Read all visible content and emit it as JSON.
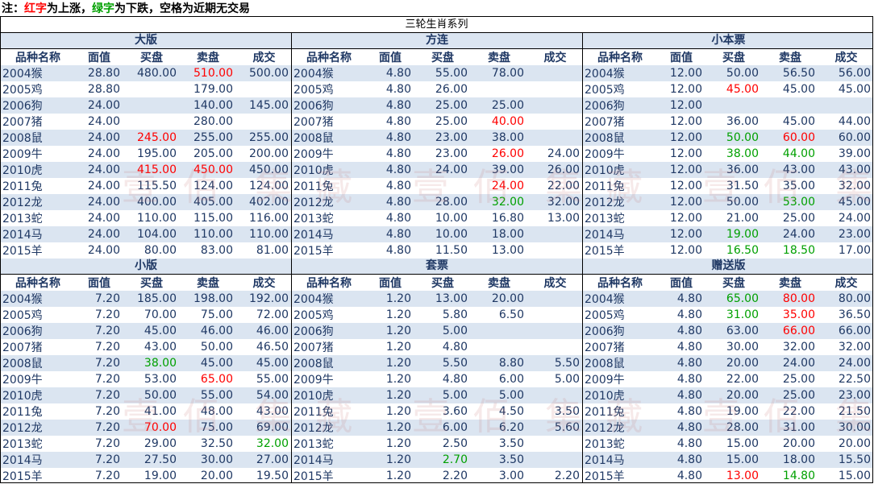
{
  "note": {
    "prefix": "注：",
    "red_word": "红字",
    "red_rest": "为上涨，",
    "green_word": "绿字",
    "green_rest": "为下跌，空格为近期无交易"
  },
  "title": "三轮生肖系列",
  "colors": {
    "up": "#ff0000",
    "down": "#00a000",
    "text": "#1f3864",
    "stripe": "#dbe5f1"
  },
  "columns": [
    "品种名称",
    "面值",
    "买盘",
    "卖盘",
    "成交"
  ],
  "sections": [
    {
      "title": "大版",
      "rows": [
        {
          "name": "2004猴",
          "face": "28.80",
          "bid": "480.00",
          "ask": "510.00",
          "deal": "500.00",
          "bid_c": "",
          "ask_c": "up",
          "deal_c": ""
        },
        {
          "name": "2005鸡",
          "face": "28.80",
          "bid": "",
          "ask": "179.00",
          "deal": "",
          "bid_c": "",
          "ask_c": "",
          "deal_c": ""
        },
        {
          "name": "2006狗",
          "face": "24.00",
          "bid": "",
          "ask": "140.00",
          "deal": "145.00",
          "bid_c": "",
          "ask_c": "",
          "deal_c": ""
        },
        {
          "name": "2007猪",
          "face": "24.00",
          "bid": "",
          "ask": "280.00",
          "deal": "",
          "bid_c": "",
          "ask_c": "",
          "deal_c": ""
        },
        {
          "name": "2008鼠",
          "face": "24.00",
          "bid": "245.00",
          "ask": "255.00",
          "deal": "255.00",
          "bid_c": "up",
          "ask_c": "",
          "deal_c": ""
        },
        {
          "name": "2009牛",
          "face": "24.00",
          "bid": "195.00",
          "ask": "205.00",
          "deal": "200.00",
          "bid_c": "",
          "ask_c": "",
          "deal_c": ""
        },
        {
          "name": "2010虎",
          "face": "24.00",
          "bid": "415.00",
          "ask": "450.00",
          "deal": "450.00",
          "bid_c": "up",
          "ask_c": "up",
          "deal_c": ""
        },
        {
          "name": "2011兔",
          "face": "24.00",
          "bid": "115.50",
          "ask": "124.00",
          "deal": "124.00",
          "bid_c": "",
          "ask_c": "",
          "deal_c": ""
        },
        {
          "name": "2012龙",
          "face": "24.00",
          "bid": "400.00",
          "ask": "405.00",
          "deal": "402.00",
          "bid_c": "",
          "ask_c": "",
          "deal_c": ""
        },
        {
          "name": "2013蛇",
          "face": "24.00",
          "bid": "110.00",
          "ask": "115.00",
          "deal": "116.00",
          "bid_c": "",
          "ask_c": "",
          "deal_c": ""
        },
        {
          "name": "2014马",
          "face": "24.00",
          "bid": "104.00",
          "ask": "110.00",
          "deal": "110.00",
          "bid_c": "",
          "ask_c": "",
          "deal_c": ""
        },
        {
          "name": "2015羊",
          "face": "24.00",
          "bid": "80.00",
          "ask": "83.00",
          "deal": "81.00",
          "bid_c": "",
          "ask_c": "",
          "deal_c": ""
        }
      ]
    },
    {
      "title": "方连",
      "rows": [
        {
          "name": "2004猴",
          "face": "4.80",
          "bid": "55.00",
          "ask": "78.00",
          "deal": "",
          "bid_c": "",
          "ask_c": "",
          "deal_c": ""
        },
        {
          "name": "2005鸡",
          "face": "4.80",
          "bid": "26.00",
          "ask": "",
          "deal": "",
          "bid_c": "",
          "ask_c": "",
          "deal_c": ""
        },
        {
          "name": "2006狗",
          "face": "4.80",
          "bid": "25.00",
          "ask": "25.00",
          "deal": "",
          "bid_c": "",
          "ask_c": "",
          "deal_c": ""
        },
        {
          "name": "2007猪",
          "face": "4.80",
          "bid": "25.00",
          "ask": "40.00",
          "deal": "",
          "bid_c": "",
          "ask_c": "up",
          "deal_c": ""
        },
        {
          "name": "2008鼠",
          "face": "4.80",
          "bid": "23.00",
          "ask": "38.00",
          "deal": "",
          "bid_c": "",
          "ask_c": "",
          "deal_c": ""
        },
        {
          "name": "2009牛",
          "face": "4.80",
          "bid": "23.00",
          "ask": "26.00",
          "deal": "24.00",
          "bid_c": "",
          "ask_c": "up",
          "deal_c": ""
        },
        {
          "name": "2010虎",
          "face": "4.80",
          "bid": "24.00",
          "ask": "39.00",
          "deal": "26.00",
          "bid_c": "",
          "ask_c": "",
          "deal_c": ""
        },
        {
          "name": "2011兔",
          "face": "4.80",
          "bid": "",
          "ask": "24.00",
          "deal": "22.00",
          "bid_c": "",
          "ask_c": "up",
          "deal_c": ""
        },
        {
          "name": "2012龙",
          "face": "4.80",
          "bid": "28.00",
          "ask": "32.00",
          "deal": "32.00",
          "bid_c": "",
          "ask_c": "down",
          "deal_c": ""
        },
        {
          "name": "2013蛇",
          "face": "4.80",
          "bid": "10.00",
          "ask": "16.80",
          "deal": "13.00",
          "bid_c": "",
          "ask_c": "",
          "deal_c": ""
        },
        {
          "name": "2014马",
          "face": "4.80",
          "bid": "10.00",
          "ask": "18.00",
          "deal": "",
          "bid_c": "",
          "ask_c": "",
          "deal_c": ""
        },
        {
          "name": "2015羊",
          "face": "4.80",
          "bid": "11.50",
          "ask": "13.00",
          "deal": "",
          "bid_c": "",
          "ask_c": "",
          "deal_c": ""
        }
      ]
    },
    {
      "title": "小本票",
      "rows": [
        {
          "name": "2004猴",
          "face": "12.00",
          "bid": "50.00",
          "ask": "56.50",
          "deal": "56.00",
          "bid_c": "",
          "ask_c": "",
          "deal_c": ""
        },
        {
          "name": "2005鸡",
          "face": "12.00",
          "bid": "45.00",
          "ask": "45.00",
          "deal": "45.00",
          "bid_c": "up",
          "ask_c": "",
          "deal_c": ""
        },
        {
          "name": "2006狗",
          "face": "12.00",
          "bid": "",
          "ask": "",
          "deal": "",
          "bid_c": "",
          "ask_c": "",
          "deal_c": ""
        },
        {
          "name": "2007猪",
          "face": "12.00",
          "bid": "36.00",
          "ask": "45.00",
          "deal": "44.00",
          "bid_c": "",
          "ask_c": "",
          "deal_c": ""
        },
        {
          "name": "2008鼠",
          "face": "12.00",
          "bid": "50.00",
          "ask": "60.00",
          "deal": "60.00",
          "bid_c": "down",
          "ask_c": "up",
          "deal_c": ""
        },
        {
          "name": "2009牛",
          "face": "12.00",
          "bid": "38.00",
          "ask": "44.00",
          "deal": "39.00",
          "bid_c": "down",
          "ask_c": "down",
          "deal_c": ""
        },
        {
          "name": "2010虎",
          "face": "12.00",
          "bid": "36.00",
          "ask": "43.00",
          "deal": "43.00",
          "bid_c": "",
          "ask_c": "",
          "deal_c": ""
        },
        {
          "name": "2011兔",
          "face": "12.00",
          "bid": "31.50",
          "ask": "35.00",
          "deal": "32.00",
          "bid_c": "",
          "ask_c": "",
          "deal_c": ""
        },
        {
          "name": "2012龙",
          "face": "12.00",
          "bid": "50.00",
          "ask": "53.00",
          "deal": "45.00",
          "bid_c": "",
          "ask_c": "down",
          "deal_c": ""
        },
        {
          "name": "2013蛇",
          "face": "12.00",
          "bid": "21.00",
          "ask": "25.00",
          "deal": "24.00",
          "bid_c": "",
          "ask_c": "",
          "deal_c": ""
        },
        {
          "name": "2014马",
          "face": "12.00",
          "bid": "19.00",
          "ask": "24.00",
          "deal": "23.00",
          "bid_c": "down",
          "ask_c": "",
          "deal_c": ""
        },
        {
          "name": "2015羊",
          "face": "12.00",
          "bid": "16.50",
          "ask": "18.50",
          "deal": "17.00",
          "bid_c": "down",
          "ask_c": "down",
          "deal_c": ""
        }
      ]
    },
    {
      "title": "小版",
      "rows": [
        {
          "name": "2004猴",
          "face": "7.20",
          "bid": "185.00",
          "ask": "198.00",
          "deal": "192.00",
          "bid_c": "",
          "ask_c": "",
          "deal_c": ""
        },
        {
          "name": "2005鸡",
          "face": "7.20",
          "bid": "70.00",
          "ask": "75.00",
          "deal": "72.00",
          "bid_c": "",
          "ask_c": "",
          "deal_c": ""
        },
        {
          "name": "2006狗",
          "face": "7.20",
          "bid": "45.00",
          "ask": "46.00",
          "deal": "46.00",
          "bid_c": "",
          "ask_c": "",
          "deal_c": ""
        },
        {
          "name": "2007猪",
          "face": "7.20",
          "bid": "43.00",
          "ask": "50.00",
          "deal": "46.50",
          "bid_c": "",
          "ask_c": "",
          "deal_c": ""
        },
        {
          "name": "2008鼠",
          "face": "7.20",
          "bid": "38.00",
          "ask": "45.00",
          "deal": "45.00",
          "bid_c": "down",
          "ask_c": "",
          "deal_c": ""
        },
        {
          "name": "2009牛",
          "face": "7.20",
          "bid": "53.00",
          "ask": "65.00",
          "deal": "55.00",
          "bid_c": "",
          "ask_c": "up",
          "deal_c": ""
        },
        {
          "name": "2010虎",
          "face": "7.20",
          "bid": "50.00",
          "ask": "55.00",
          "deal": "54.00",
          "bid_c": "",
          "ask_c": "",
          "deal_c": ""
        },
        {
          "name": "2011兔",
          "face": "7.20",
          "bid": "41.00",
          "ask": "48.00",
          "deal": "43.00",
          "bid_c": "",
          "ask_c": "",
          "deal_c": ""
        },
        {
          "name": "2012龙",
          "face": "7.20",
          "bid": "70.00",
          "ask": "75.00",
          "deal": "69.00",
          "bid_c": "up",
          "ask_c": "",
          "deal_c": ""
        },
        {
          "name": "2013蛇",
          "face": "7.20",
          "bid": "29.00",
          "ask": "32.50",
          "deal": "32.00",
          "bid_c": "",
          "ask_c": "",
          "deal_c": "down"
        },
        {
          "name": "2014马",
          "face": "7.20",
          "bid": "27.50",
          "ask": "30.00",
          "deal": "27.00",
          "bid_c": "",
          "ask_c": "",
          "deal_c": ""
        },
        {
          "name": "2015羊",
          "face": "7.20",
          "bid": "19.00",
          "ask": "20.00",
          "deal": "19.50",
          "bid_c": "",
          "ask_c": "",
          "deal_c": ""
        }
      ]
    },
    {
      "title": "套票",
      "rows": [
        {
          "name": "2004猴",
          "face": "1.20",
          "bid": "13.00",
          "ask": "20.00",
          "deal": "",
          "bid_c": "",
          "ask_c": "",
          "deal_c": ""
        },
        {
          "name": "2005鸡",
          "face": "1.20",
          "bid": "5.80",
          "ask": "6.50",
          "deal": "",
          "bid_c": "",
          "ask_c": "",
          "deal_c": ""
        },
        {
          "name": "2006狗",
          "face": "1.20",
          "bid": "5.00",
          "ask": "",
          "deal": "",
          "bid_c": "",
          "ask_c": "",
          "deal_c": ""
        },
        {
          "name": "2007猪",
          "face": "1.20",
          "bid": "4.80",
          "ask": "",
          "deal": "",
          "bid_c": "",
          "ask_c": "",
          "deal_c": ""
        },
        {
          "name": "2008鼠",
          "face": "1.20",
          "bid": "5.50",
          "ask": "8.80",
          "deal": "5.50",
          "bid_c": "",
          "ask_c": "",
          "deal_c": ""
        },
        {
          "name": "2009牛",
          "face": "1.20",
          "bid": "4.80",
          "ask": "6.00",
          "deal": "5.00",
          "bid_c": "",
          "ask_c": "",
          "deal_c": ""
        },
        {
          "name": "2010虎",
          "face": "1.20",
          "bid": "5.00",
          "ask": "5.00",
          "deal": "",
          "bid_c": "",
          "ask_c": "",
          "deal_c": ""
        },
        {
          "name": "2011兔",
          "face": "1.20",
          "bid": "3.60",
          "ask": "4.50",
          "deal": "3.50",
          "bid_c": "",
          "ask_c": "",
          "deal_c": ""
        },
        {
          "name": "2012龙",
          "face": "1.20",
          "bid": "6.00",
          "ask": "6.20",
          "deal": "5.60",
          "bid_c": "",
          "ask_c": "",
          "deal_c": ""
        },
        {
          "name": "2013蛇",
          "face": "1.20",
          "bid": "2.50",
          "ask": "3.50",
          "deal": "",
          "bid_c": "",
          "ask_c": "",
          "deal_c": ""
        },
        {
          "name": "2014马",
          "face": "1.20",
          "bid": "2.70",
          "ask": "3.50",
          "deal": "",
          "bid_c": "down",
          "ask_c": "",
          "deal_c": ""
        },
        {
          "name": "2015羊",
          "face": "1.20",
          "bid": "2.20",
          "ask": "3.00",
          "deal": "2.20",
          "bid_c": "",
          "ask_c": "",
          "deal_c": ""
        }
      ]
    },
    {
      "title": "赠送版",
      "rows": [
        {
          "name": "2004猴",
          "face": "4.80",
          "bid": "65.00",
          "ask": "80.00",
          "deal": "80.00",
          "bid_c": "down",
          "ask_c": "up",
          "deal_c": ""
        },
        {
          "name": "2005鸡",
          "face": "4.80",
          "bid": "31.00",
          "ask": "35.00",
          "deal": "36.50",
          "bid_c": "down",
          "ask_c": "up",
          "deal_c": ""
        },
        {
          "name": "2006狗",
          "face": "4.80",
          "bid": "63.00",
          "ask": "66.00",
          "deal": "66.00",
          "bid_c": "",
          "ask_c": "up",
          "deal_c": ""
        },
        {
          "name": "2007猪",
          "face": "4.80",
          "bid": "30.00",
          "ask": "32.00",
          "deal": "32.00",
          "bid_c": "",
          "ask_c": "",
          "deal_c": ""
        },
        {
          "name": "2008鼠",
          "face": "4.80",
          "bid": "20.00",
          "ask": "24.00",
          "deal": "24.00",
          "bid_c": "",
          "ask_c": "",
          "deal_c": ""
        },
        {
          "name": "2009牛",
          "face": "4.80",
          "bid": "22.00",
          "ask": "25.00",
          "deal": "22.50",
          "bid_c": "",
          "ask_c": "",
          "deal_c": ""
        },
        {
          "name": "2010虎",
          "face": "4.80",
          "bid": "20.00",
          "ask": "25.00",
          "deal": "23.00",
          "bid_c": "",
          "ask_c": "",
          "deal_c": ""
        },
        {
          "name": "2011兔",
          "face": "4.80",
          "bid": "19.00",
          "ask": "22.00",
          "deal": "21.50",
          "bid_c": "",
          "ask_c": "",
          "deal_c": ""
        },
        {
          "name": "2012龙",
          "face": "4.80",
          "bid": "28.00",
          "ask": "31.00",
          "deal": "30.00",
          "bid_c": "",
          "ask_c": "",
          "deal_c": ""
        },
        {
          "name": "2013蛇",
          "face": "4.80",
          "bid": "15.00",
          "ask": "20.00",
          "deal": "20.00",
          "bid_c": "",
          "ask_c": "",
          "deal_c": ""
        },
        {
          "name": "2014马",
          "face": "4.80",
          "bid": "15.00",
          "ask": "18.00",
          "deal": "15.50",
          "bid_c": "",
          "ask_c": "",
          "deal_c": ""
        },
        {
          "name": "2015羊",
          "face": "4.80",
          "bid": "13.00",
          "ask": "14.80",
          "deal": "15.00",
          "bid_c": "up",
          "ask_c": "down",
          "deal_c": ""
        }
      ]
    }
  ]
}
